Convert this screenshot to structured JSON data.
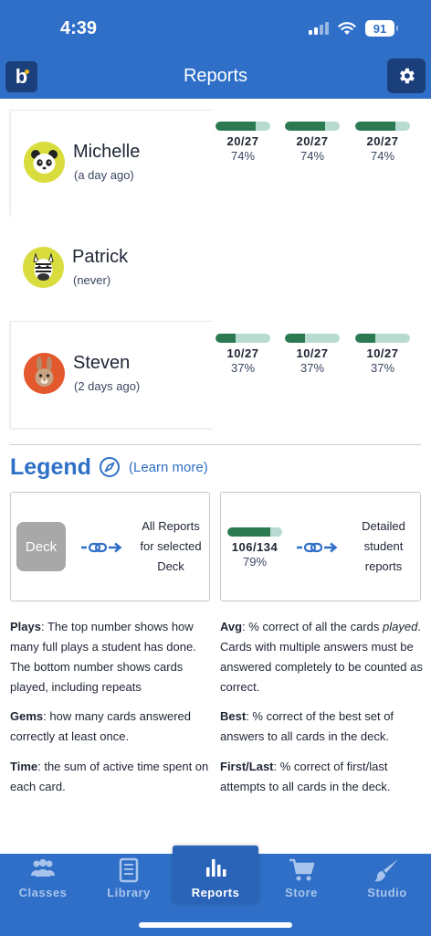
{
  "status_bar": {
    "time": "4:39",
    "battery": "91"
  },
  "header": {
    "title": "Reports",
    "app_glyph": "b",
    "settings_icon": "gear-icon"
  },
  "students": [
    {
      "name": "Michelle",
      "last_seen": "(a day ago)",
      "avatar": "panda",
      "stats": [
        {
          "frac": "20/27",
          "pct": "74%",
          "fill": 0.74
        },
        {
          "frac": "20/27",
          "pct": "74%",
          "fill": 0.74
        },
        {
          "frac": "20/27",
          "pct": "74%",
          "fill": 0.74
        }
      ]
    },
    {
      "name": "Patrick",
      "last_seen": "(never)",
      "avatar": "zebra",
      "stats": []
    },
    {
      "name": "Steven",
      "last_seen": "(2 days ago)",
      "avatar": "rabbit",
      "stats": [
        {
          "frac": "10/27",
          "pct": "37%",
          "fill": 0.37
        },
        {
          "frac": "10/27",
          "pct": "37%",
          "fill": 0.37
        },
        {
          "frac": "10/27",
          "pct": "37%",
          "fill": 0.37
        }
      ]
    }
  ],
  "legend": {
    "title": "Legend",
    "learn_more": "(Learn more)",
    "deck_label": "Deck",
    "deck_desc": [
      "All Reports",
      "for selected",
      "Deck"
    ],
    "sample_frac": "106/134",
    "sample_pct": "79%",
    "sample_fill": 0.79,
    "detail_desc": [
      "Detailed",
      "student",
      "reports"
    ],
    "defs": {
      "plays_term": "Plays",
      "plays_text": ": The top number shows how many full plays a student has done. The bottom number shows cards played, including repeats",
      "gems_term": "Gems",
      "gems_text": ": how many cards answered correctly at least once.",
      "time_term": "Time",
      "time_text": ": the sum of active time spent on each card.",
      "avg_term": "Avg",
      "avg_text_1": ": % correct of all the cards ",
      "avg_text_italic": "played",
      "avg_text_2": ". Cards with multiple answers must be answered completely to be counted as correct.",
      "best_term": "Best",
      "best_text": ": % correct of the best set of answers to all cards in the deck.",
      "firstlast_term": "First/Last",
      "firstlast_text": ": % correct of first/last attempts to all cards in the deck."
    }
  },
  "tabs": [
    {
      "label": "Classes",
      "icon": "people-icon",
      "active": false
    },
    {
      "label": "Library",
      "icon": "book-icon",
      "active": false
    },
    {
      "label": "Reports",
      "icon": "bar-chart-icon",
      "active": true
    },
    {
      "label": "Store",
      "icon": "cart-icon",
      "active": false
    },
    {
      "label": "Studio",
      "icon": "brush-icon",
      "active": false
    }
  ]
}
